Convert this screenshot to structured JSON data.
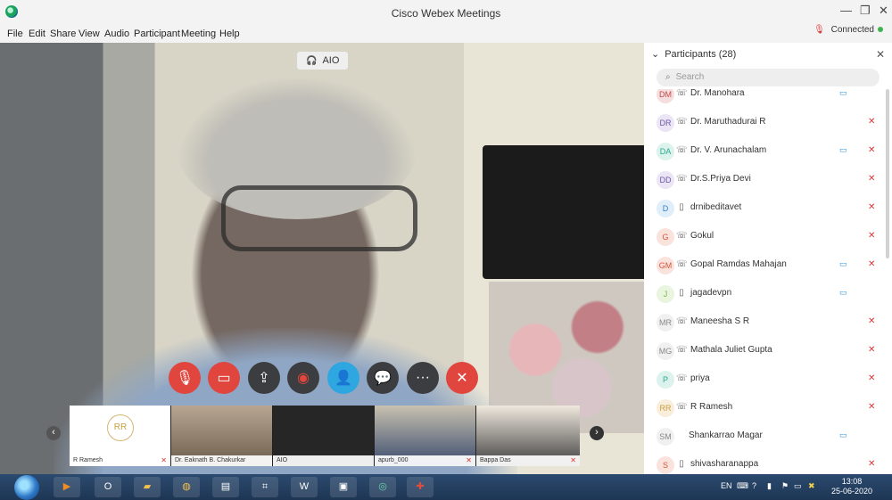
{
  "window": {
    "title": "Cisco Webex Meetings"
  },
  "menu": [
    "File",
    "Edit",
    "Share",
    "View",
    "Audio",
    "Participant",
    "Meeting",
    "Help"
  ],
  "connection": {
    "label": "Connected",
    "status_color": "#3fb34f"
  },
  "speaker": {
    "label": "AIO"
  },
  "controls": {
    "more_label": "···",
    "end_label": "✕"
  },
  "thumbnails": [
    {
      "name": "R Ramesh",
      "initials": "RR"
    },
    {
      "name": "Dr. Eaknath B. Chakurkar"
    },
    {
      "name": "AIO"
    },
    {
      "name": "apurb_000"
    },
    {
      "name": "Bappa Das"
    }
  ],
  "participants_panel": {
    "title": "Participants (28)",
    "search_placeholder": "Search",
    "participants": [
      {
        "initials": "DM",
        "name": "Dr. Manohara",
        "audio": "voip",
        "video": true,
        "muted": false
      },
      {
        "initials": "DR",
        "name": "Dr. Maruthadurai R",
        "audio": "voip",
        "video": false,
        "muted": true
      },
      {
        "initials": "DA",
        "name": "Dr. V. Arunachalam",
        "audio": "voip",
        "video": true,
        "muted": true
      },
      {
        "initials": "DD",
        "name": "Dr.S.Priya Devi",
        "audio": "voip",
        "video": false,
        "muted": true
      },
      {
        "initials": "D",
        "name": "drnibeditavet",
        "audio": "phone",
        "video": false,
        "muted": true
      },
      {
        "initials": "G",
        "name": "Gokul",
        "audio": "voip",
        "video": false,
        "muted": true
      },
      {
        "initials": "GM",
        "name": "Gopal Ramdas Mahajan",
        "audio": "voip",
        "video": true,
        "muted": true
      },
      {
        "initials": "J",
        "name": "jagadevpn",
        "audio": "phone",
        "video": true,
        "muted": false
      },
      {
        "initials": "MR",
        "name": "Maneesha S R",
        "audio": "voip",
        "video": false,
        "muted": true
      },
      {
        "initials": "MG",
        "name": "Mathala Juliet Gupta",
        "audio": "voip",
        "video": false,
        "muted": true
      },
      {
        "initials": "P",
        "name": "priya",
        "audio": "voip",
        "video": false,
        "muted": true
      },
      {
        "initials": "RR",
        "name": "R Ramesh",
        "audio": "voip",
        "video": false,
        "muted": true
      },
      {
        "initials": "SM",
        "name": "Shankarrao Magar",
        "audio": "none",
        "video": true,
        "muted": false
      },
      {
        "initials": "S",
        "name": "shivasharanappa",
        "audio": "phone",
        "video": false,
        "muted": true
      }
    ]
  },
  "taskbar": {
    "language": "EN",
    "time": "13:08",
    "date": "25-06-2020"
  }
}
